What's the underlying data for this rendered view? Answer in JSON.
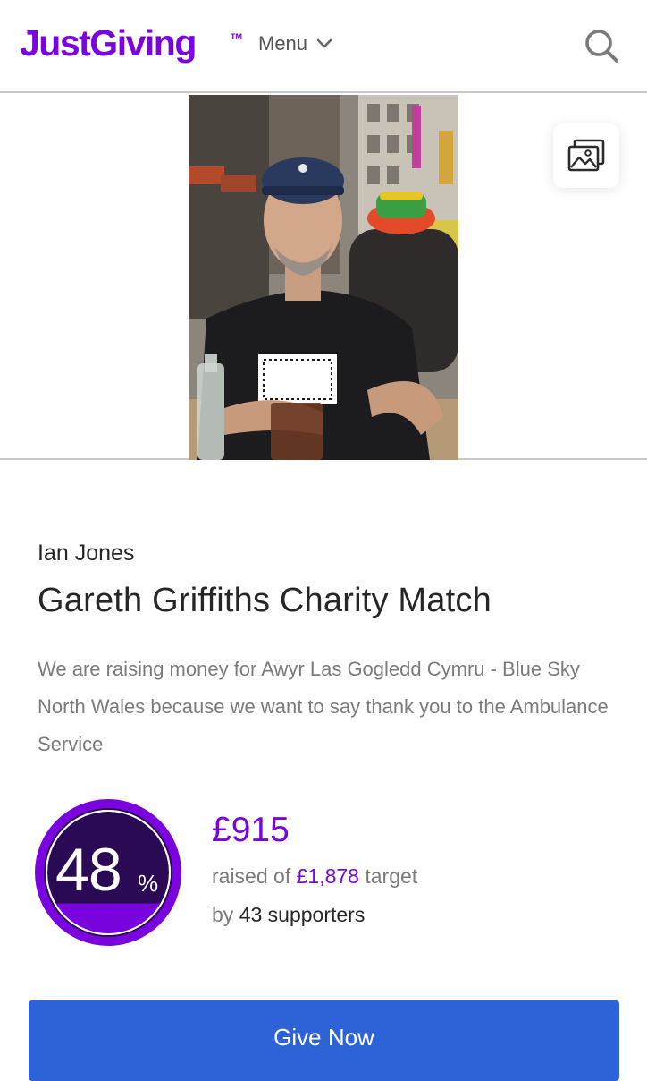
{
  "header": {
    "logo": "JustGiving",
    "logo_tm": "TM",
    "menu_label": "Menu"
  },
  "page": {
    "owner": "Ian Jones",
    "title": "Gareth Griffiths Charity Match",
    "description": "We are raising money for Awyr Las Gogledd Cymru - Blue Sky North Wales because we want to say thank you to the Ambulance Service"
  },
  "progress": {
    "percent_value": 48,
    "percent_number": "48",
    "percent_sign": "%",
    "raised": "£915",
    "raised_prefix": "raised of",
    "target": "£1,878",
    "target_suffix": "target",
    "supporters_prefix": "by",
    "supporters": "43 supporters"
  },
  "actions": {
    "give_label": "Give Now"
  },
  "colors": {
    "brand_purple": "#7a04dd",
    "ring_dark": "#2a0a55",
    "ring_fill": "#7a04dd",
    "button_blue": "#2d63d6"
  }
}
